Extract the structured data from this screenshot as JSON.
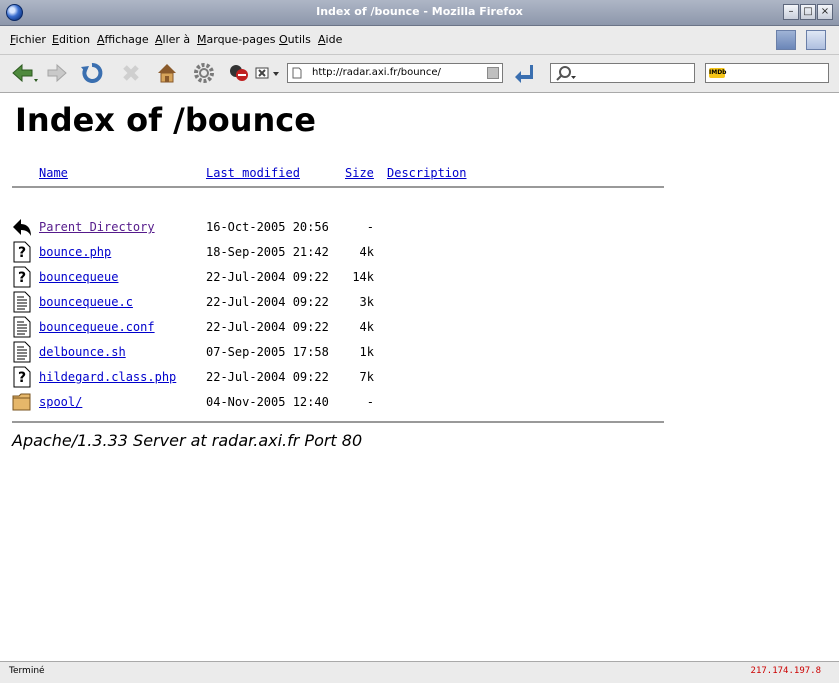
{
  "window": {
    "title": "Index of /bounce - Mozilla Firefox",
    "buttons": [
      "–",
      "□",
      "×"
    ]
  },
  "menu": {
    "items": [
      {
        "accel": "F",
        "rest": "ichier"
      },
      {
        "accel": "E",
        "rest": "dition"
      },
      {
        "accel": "A",
        "rest": "ffichage"
      },
      {
        "accel": "A",
        "rest": "ller à"
      },
      {
        "accel": "M",
        "rest": "arque-pages"
      },
      {
        "accel": "O",
        "rest": "utils"
      },
      {
        "accel": "A",
        "rest": "ide"
      }
    ]
  },
  "toolbar": {
    "url": "http://radar.axi.fr/bounce/",
    "imdb_logo": "IMDb"
  },
  "page": {
    "heading": "Index of /bounce",
    "columns": {
      "name": "Name",
      "modified": "Last modified",
      "size": "Size",
      "description": "Description"
    },
    "rows": [
      {
        "icon": "back-icon",
        "name": "Parent Directory",
        "date": "16-Oct-2005 20:56",
        "size": "-"
      },
      {
        "icon": "unknown-file-icon",
        "name": "bounce.php",
        "date": "18-Sep-2005 21:42",
        "size": "4k"
      },
      {
        "icon": "unknown-file-icon",
        "name": "bouncequeue",
        "date": "22-Jul-2004 09:22",
        "size": "14k"
      },
      {
        "icon": "text-file-icon",
        "name": "bouncequeue.c",
        "date": "22-Jul-2004 09:22",
        "size": "3k"
      },
      {
        "icon": "text-file-icon",
        "name": "bouncequeue.conf",
        "date": "22-Jul-2004 09:22",
        "size": "4k"
      },
      {
        "icon": "text-file-icon",
        "name": "delbounce.sh",
        "date": "07-Sep-2005 17:58",
        "size": "1k"
      },
      {
        "icon": "unknown-file-icon",
        "name": "hildegard.class.php",
        "date": "22-Jul-2004 09:22",
        "size": "7k"
      },
      {
        "icon": "folder-icon",
        "name": "spool/",
        "date": "04-Nov-2005 12:40",
        "size": "-"
      }
    ],
    "server_signature": "Apache/1.3.33 Server at radar.axi.fr Port 80"
  },
  "status": {
    "text": "Terminé",
    "ip": "217.174.197.8"
  },
  "colors": {
    "link": "#0000cc",
    "visited_link": "#551a8b",
    "ip_text": "#cc0000"
  }
}
